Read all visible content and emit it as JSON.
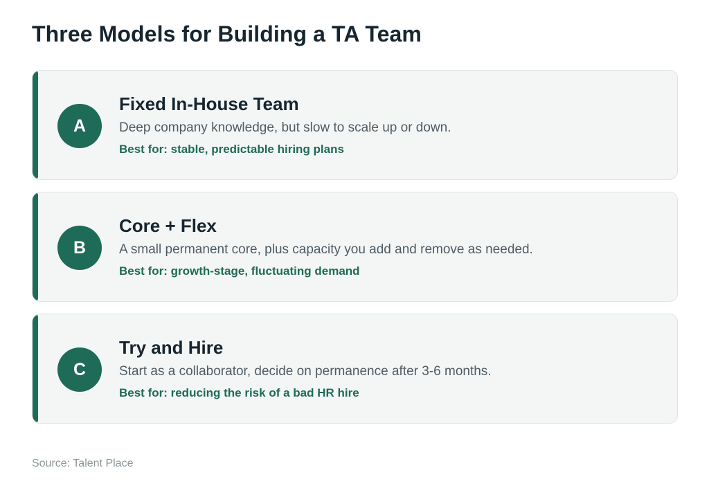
{
  "title": "Three Models for Building a TA Team",
  "colors": {
    "accent": "#1e6b57",
    "card_background": "#f4f6f6",
    "title_text": "#17252f",
    "description_text": "#4f5b63",
    "source_text": "#8a9499"
  },
  "cards": [
    {
      "badge": "A",
      "title": "Fixed In-House Team",
      "description": "Deep company knowledge, but slow to scale up or down.",
      "best_for": "Best for: stable, predictable hiring plans"
    },
    {
      "badge": "B",
      "title": "Core + Flex",
      "description": "A small permanent core, plus capacity you add and remove as needed.",
      "best_for": "Best for: growth-stage, fluctuating demand"
    },
    {
      "badge": "C",
      "title": "Try and Hire",
      "description": "Start as a collaborator, decide on permanence after 3-6 months.",
      "best_for": "Best for: reducing the risk of a bad HR hire"
    }
  ],
  "source": "Source: Talent Place"
}
